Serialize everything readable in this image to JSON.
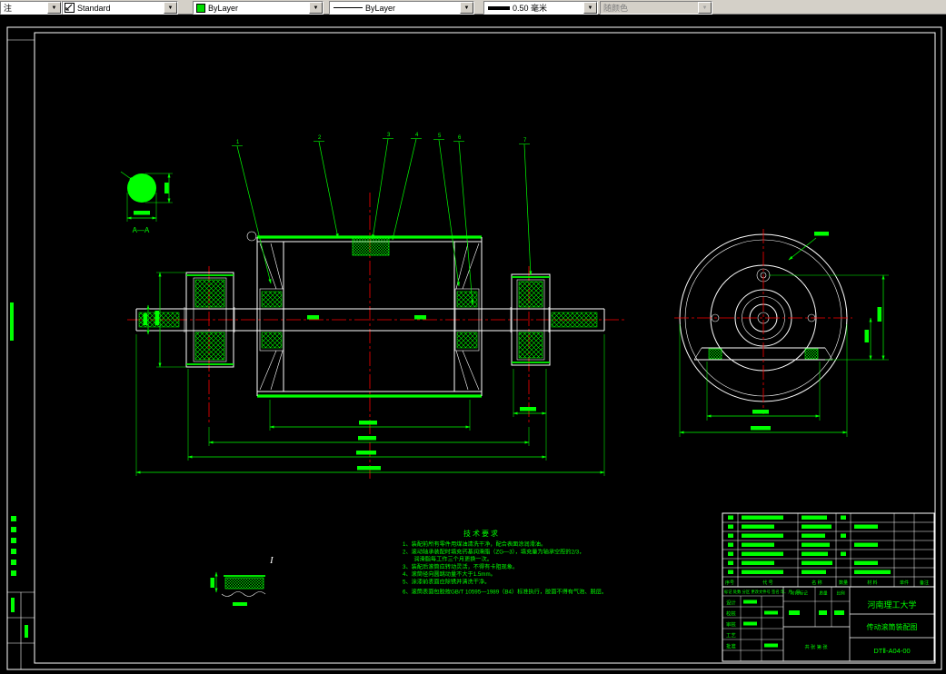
{
  "toolbar": {
    "arrow": "▼",
    "dim_partial": "注",
    "style_name": "Standard",
    "color_name": "ByLayer",
    "linetype_name": "ByLayer",
    "lineweight_name": "0.50 毫米",
    "plotstyle_name": "随颜色"
  },
  "colors": {
    "annotation": "#00FF00",
    "centerline": "#FF0000",
    "object": "#FFFFFF",
    "canvas": "#000000",
    "toolbar": "#D4D0C8",
    "swatch": "#00DD00"
  },
  "drawing": {
    "section_label": "A—A",
    "detail_label": "I",
    "callouts": [
      "1",
      "2",
      "3",
      "4",
      "5",
      "6",
      "7"
    ],
    "notes": {
      "title": "技术要求",
      "lines": [
        "1、装配前所有零件用煤油清洗干净，配合表面涂润滑油。",
        "2、滚动轴承装配时填充钙基润滑脂（ZG—3），填充量为轴承空腔的2/3，",
        "　　润滑脂每工作三个月更换一次。",
        "3、装配后滚筒应转动灵活，不得有卡阻现象。",
        "4、滚筒径向圆跳动量不大于1.5mm。",
        "5、涂漆前表面应除锈并清洗干净。",
        "6、滚筒表面包胶按GB/T 10595—1989（B4）标准执行，胶面不得有气泡、脱层。"
      ]
    },
    "title_block": {
      "school": "河南理工大学",
      "drawing_title": "传动滚筒装配图",
      "drawing_no": "DTⅡ-A04-00",
      "bom_headers": [
        "序号",
        "代 号",
        "名 称",
        "数量",
        "材 料",
        "单件",
        "备注"
      ],
      "left_labels": [
        "设计",
        "校核",
        "审核",
        "工艺",
        "批准"
      ],
      "rev_header": "标记 处数 分区 更改文件号 签名 年、月、日",
      "stage_headers": [
        "阶段标记",
        "质量",
        "比例"
      ],
      "sheet_text": "共 张 第 张"
    }
  }
}
